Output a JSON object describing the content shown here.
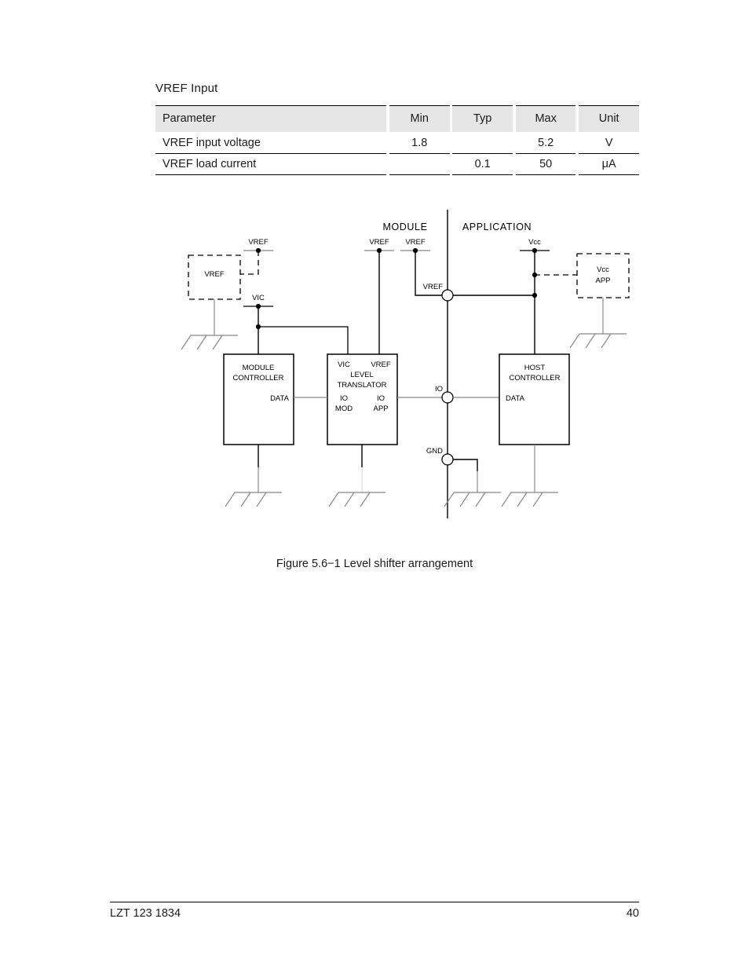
{
  "page": {
    "section_title": "VREF Input",
    "figure_caption": "Figure 5.6−1  Level shifter arrangement",
    "footer_doc_id": "LZT 123 1834",
    "footer_page_number": "40"
  },
  "table": {
    "headers": [
      "Parameter",
      "Min",
      "Typ",
      "Max",
      "Unit"
    ],
    "rows": [
      {
        "parameter": "VREF input voltage",
        "min": "1.8",
        "typ": "",
        "max": "5.2",
        "unit": "V"
      },
      {
        "parameter": "VREF load current",
        "min": "",
        "typ": "0.1",
        "max": "50",
        "unit": "μA"
      }
    ]
  },
  "figure": {
    "domain_labels": {
      "left": "MODULE",
      "right": "APPLICATION"
    },
    "blocks": [
      {
        "id": "module-controller",
        "lines": [
          "MODULE",
          "CONTROLLER"
        ],
        "pins": [
          "DATA"
        ]
      },
      {
        "id": "level-translator",
        "lines": [
          "LEVEL",
          "TRANSLATOR"
        ],
        "pins": [
          "VIC",
          "VREF",
          "IO\nMOD",
          "IO\nAPP"
        ]
      },
      {
        "id": "host-controller",
        "lines": [
          "HOST",
          "CONTROLLER"
        ],
        "pins": [
          "DATA"
        ]
      }
    ],
    "dashed_boxes": [
      {
        "id": "vref-source",
        "lines": [
          "VREF"
        ]
      },
      {
        "id": "vcc-app-source",
        "lines": [
          "Vcc",
          "APP"
        ]
      }
    ],
    "supply_terminals": [
      {
        "id": "vref-left",
        "label": "VREF"
      },
      {
        "id": "vic",
        "label": "VIC"
      },
      {
        "id": "vref-translator",
        "label": "VREF"
      },
      {
        "id": "vref-interface",
        "label": "VREF"
      },
      {
        "id": "vcc",
        "label": "Vcc"
      }
    ],
    "interface_nodes": [
      {
        "id": "node-vref",
        "label": "VREF"
      },
      {
        "id": "node-io",
        "label": "IO"
      },
      {
        "id": "node-gnd",
        "label": "GND"
      }
    ],
    "block_pin_labels": {
      "module_controller_data": "DATA",
      "translator_vic": "VIC",
      "translator_vref": "VREF",
      "translator_io_mod_1": "IO",
      "translator_io_mod_2": "MOD",
      "translator_io_app_1": "IO",
      "translator_io_app_2": "APP",
      "host_controller_data": "DATA"
    }
  }
}
